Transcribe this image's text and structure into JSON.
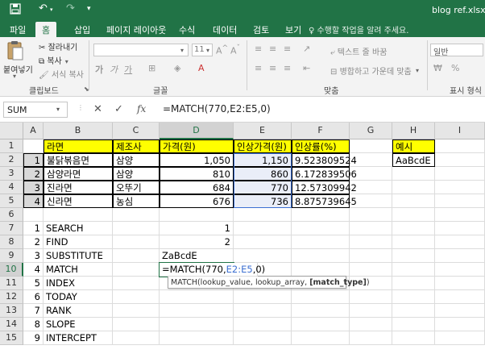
{
  "titlebar": {
    "title": "blog ref.xlsx - E",
    "save_icon": "save-icon",
    "undo_icon": "undo-icon",
    "redo_icon": "redo-icon",
    "customize_icon": "customize-quick-access-icon"
  },
  "tabs": [
    {
      "label": "파일"
    },
    {
      "label": "홈",
      "active": true
    },
    {
      "label": "삽입"
    },
    {
      "label": "페이지 레이아웃"
    },
    {
      "label": "수식"
    },
    {
      "label": "데이터"
    },
    {
      "label": "검토"
    },
    {
      "label": "보기"
    }
  ],
  "tell_me": "수행할 작업을 알려 주세요.",
  "ribbon": {
    "paste_label": "붙여넣기",
    "cut_label": "잘라내기",
    "copy_label": "복사",
    "format_painter_label": "서식 복사",
    "clipboard_group": "클립보드",
    "font_size": "11",
    "font_group": "글꼴",
    "wrap_text_label": "텍스트 줄 바꿈",
    "merge_center_label": "병합하고 가운데 맞춤",
    "alignment_group": "맞춤",
    "number_format": "일반",
    "number_group": "표시 형식",
    "bold": "가",
    "italic": "가",
    "underline": "가"
  },
  "formula_bar": {
    "name_box": "SUM",
    "cancel_icon": "✕",
    "enter_icon": "✓",
    "fx_label": "fx",
    "formula": "=MATCH(770,E2:E5,0)"
  },
  "columns": [
    "A",
    "B",
    "C",
    "D",
    "E",
    "F",
    "G",
    "H",
    "I"
  ],
  "rows": [
    "1",
    "2",
    "3",
    "4",
    "5",
    "6",
    "7",
    "8",
    "9",
    "10",
    "11",
    "12",
    "13",
    "14",
    "15"
  ],
  "table": {
    "headers": [
      "라면",
      "제조사",
      "가격(원)",
      "인상가격(원)",
      "인상률(%)"
    ],
    "data": [
      {
        "idx": "1",
        "name": "불닭볶음면",
        "maker": "삼양",
        "price": "1,050",
        "new_price": "1,150",
        "rate": "9.523809524"
      },
      {
        "idx": "2",
        "name": "삼양라면",
        "maker": "삼양",
        "price": "810",
        "new_price": "860",
        "rate": "6.172839506"
      },
      {
        "idx": "3",
        "name": "진라면",
        "maker": "오뚜기",
        "price": "684",
        "new_price": "770",
        "rate": "12.57309942"
      },
      {
        "idx": "4",
        "name": "신라면",
        "maker": "농심",
        "price": "676",
        "new_price": "736",
        "rate": "8.875739645"
      }
    ]
  },
  "example": {
    "header": "예시",
    "value": "AaBcdE"
  },
  "functions": [
    {
      "idx": "1",
      "name": "SEARCH",
      "result": "1"
    },
    {
      "idx": "2",
      "name": "FIND",
      "result": "2"
    },
    {
      "idx": "3",
      "name": "SUBSTITUTE",
      "result": "ZaBcdE"
    },
    {
      "idx": "4",
      "name": "MATCH",
      "result": ""
    },
    {
      "idx": "5",
      "name": "INDEX",
      "result": ""
    },
    {
      "idx": "6",
      "name": "TODAY",
      "result": ""
    },
    {
      "idx": "7",
      "name": "RANK",
      "result": ""
    },
    {
      "idx": "8",
      "name": "SLOPE",
      "result": ""
    },
    {
      "idx": "9",
      "name": "INTERCEPT",
      "result": ""
    }
  ],
  "edit_cell": {
    "prefix": "=MATCH(770,",
    "range": "E2:E5",
    "suffix": ",0)"
  },
  "tooltip": {
    "prefix": "MATCH(lookup_value, lookup_array, ",
    "bold": "[match_type]",
    "suffix": ")"
  },
  "colors": {
    "excel_green": "#217346",
    "header_yellow": "#ffff00",
    "range_blue": "#3c6fd1"
  }
}
